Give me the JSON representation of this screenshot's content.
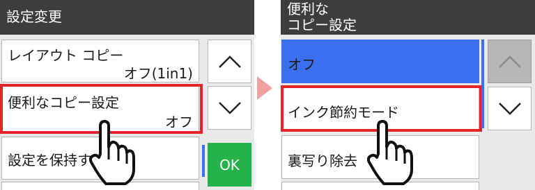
{
  "left_screen": {
    "title": "設定変更",
    "items": [
      {
        "label": "レイアウト コピー",
        "value": "オフ(1in1)"
      },
      {
        "label": "便利なコピー設定",
        "value": "オフ"
      },
      {
        "label": "設定を保持す"
      }
    ],
    "ok_label": "OK",
    "up_icon": "chevron-up-icon",
    "down_icon": "chevron-down-icon"
  },
  "right_screen": {
    "title_line1": "便利な",
    "title_line2": "コピー設定",
    "items": [
      {
        "label": "オフ"
      },
      {
        "label": "インク節約モード"
      },
      {
        "label": "裏写り除去"
      }
    ],
    "up_icon": "chevron-up-icon",
    "down_icon": "chevron-down-icon"
  },
  "colors": {
    "title_bar": "#3d3d3d",
    "selected_item": "#3a6ff0",
    "highlight_border": "#e3242b",
    "ok_button": "#23b34a",
    "transition_arrow": "#f2a0a0"
  },
  "icons": {
    "transition_arrow": "arrow-right-icon",
    "tap_hand": "pointing-hand-icon"
  }
}
